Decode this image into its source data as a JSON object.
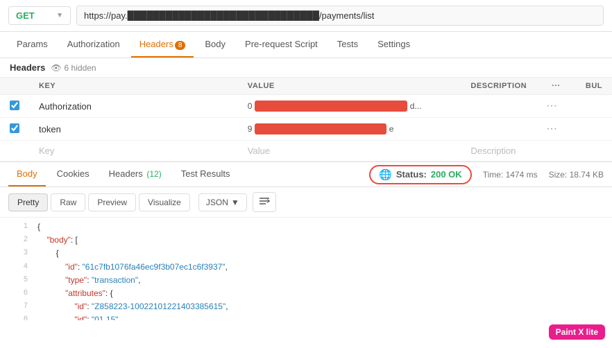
{
  "url_bar": {
    "method": "GET",
    "url": "https://pay.██████████████████████████████/payments/list"
  },
  "req_tabs": [
    {
      "label": "Params",
      "active": false,
      "badge": null
    },
    {
      "label": "Authorization",
      "active": false,
      "badge": null
    },
    {
      "label": "Headers",
      "active": true,
      "badge": "8"
    },
    {
      "label": "Body",
      "active": false,
      "badge": null
    },
    {
      "label": "Pre-request Script",
      "active": false,
      "badge": null
    },
    {
      "label": "Tests",
      "active": false,
      "badge": null
    },
    {
      "label": "Settings",
      "active": false,
      "badge": null
    }
  ],
  "headers_section": {
    "title": "Headers",
    "hidden_count": "6 hidden",
    "columns": [
      "KEY",
      "VALUE",
      "DESCRIPTION",
      "···",
      "Bul"
    ],
    "rows": [
      {
        "checked": true,
        "key": "Authorization",
        "value_redacted": true,
        "value_prefix": "0",
        "value_suffix": "d...",
        "description": ""
      },
      {
        "checked": true,
        "key": "token",
        "value_redacted": true,
        "value_prefix": "9",
        "value_suffix": "e",
        "description": ""
      }
    ],
    "placeholder_row": {
      "key": "Key",
      "value": "Value",
      "description": "Description"
    }
  },
  "res_tabs": [
    {
      "label": "Body",
      "active": true,
      "badge": null
    },
    {
      "label": "Cookies",
      "active": false,
      "badge": null
    },
    {
      "label": "Headers",
      "active": false,
      "badge": "12"
    },
    {
      "label": "Test Results",
      "active": false,
      "badge": null
    }
  ],
  "response_status": {
    "status_label": "Status:",
    "status_code": "200 OK",
    "time_label": "Time: 1474 ms",
    "size_label": "Size: 18.74 KB"
  },
  "res_toolbar": {
    "views": [
      "Pretty",
      "Raw",
      "Preview",
      "Visualize"
    ],
    "active_view": "Pretty",
    "format": "JSON"
  },
  "json_lines": [
    {
      "num": 1,
      "content": "{",
      "type": "punct"
    },
    {
      "num": 2,
      "content": "    \"body\":  [",
      "type": "mixed",
      "key": "\"body\"",
      "rest": ":  ["
    },
    {
      "num": 3,
      "content": "        {",
      "type": "punct"
    },
    {
      "num": 4,
      "content": "            \"id\":  \"61c7fb1076fa46ec9f3b07ec1c6f3937\",",
      "type": "kv",
      "key": "\"id\"",
      "val": "\"61c7fb1076fa46ec9f3b07ec1c6f3937\""
    },
    {
      "num": 5,
      "content": "            \"type\":  \"transaction\",",
      "type": "kv",
      "key": "\"type\"",
      "val": "\"transaction\""
    },
    {
      "num": 6,
      "content": "            \"attributes\":  {",
      "type": "mixed",
      "key": "\"attributes\"",
      "rest": ":  {"
    },
    {
      "num": 7,
      "content": "                \"id\":  \"Z858223-10022101221403385615\",",
      "type": "kv",
      "key": "\"id\"",
      "val": "\"Z858223-10022101221403385615\""
    },
    {
      "num": 8,
      "content": "                ...",
      "type": "punct"
    }
  ],
  "paint_badge": "Paint X lite"
}
